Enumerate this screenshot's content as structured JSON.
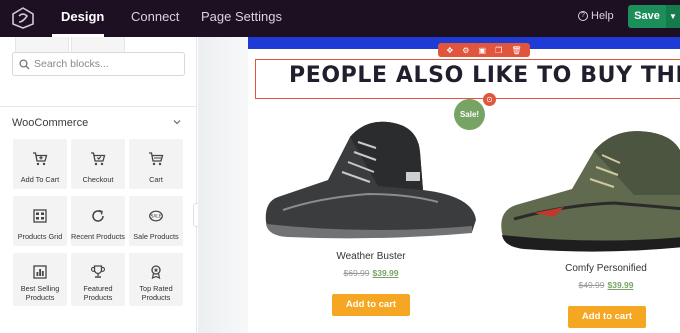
{
  "topbar": {
    "tabs": [
      {
        "label": "Design",
        "active": true
      },
      {
        "label": "Connect",
        "active": false
      },
      {
        "label": "Page Settings",
        "active": false
      }
    ],
    "help_label": "Help",
    "save_label": "Save",
    "save_menu_icon": "caret-down-icon"
  },
  "sidebar": {
    "search": {
      "placeholder": "Search blocks...",
      "value": ""
    },
    "section_title": "WooCommerce",
    "blocks": [
      {
        "label": "Add To Cart",
        "icon": "cart-plus-icon"
      },
      {
        "label": "Checkout",
        "icon": "cart-checkout-icon"
      },
      {
        "label": "Cart",
        "icon": "cart-icon"
      },
      {
        "label": "Products Grid",
        "icon": "grid-icon"
      },
      {
        "label": "Recent Products",
        "icon": "refresh-icon"
      },
      {
        "label": "Sale Products",
        "icon": "sale-tag-icon"
      },
      {
        "label": "Best Selling Products",
        "icon": "chart-icon"
      },
      {
        "label": "Featured Products",
        "icon": "trophy-icon"
      },
      {
        "label": "Top Rated Products",
        "icon": "award-icon"
      }
    ]
  },
  "canvas": {
    "heading": "PEOPLE ALSO LIKE TO BUY THESE..",
    "sale_badge": "Sale!",
    "products": [
      {
        "name": "Weather Buster",
        "old_price": "$69.99",
        "new_price": "$39.99",
        "button": "Add to cart"
      },
      {
        "name": "Comfy Personified",
        "old_price": "$49.99",
        "new_price": "$39.99",
        "button": "Add to cart"
      }
    ]
  },
  "colors": {
    "topbar": "#1d1023",
    "save": "#1b8e5a",
    "accent": "#e0553b",
    "band": "#1f3bd6",
    "sale": "#77a464",
    "cart_button": "#f5a623"
  }
}
